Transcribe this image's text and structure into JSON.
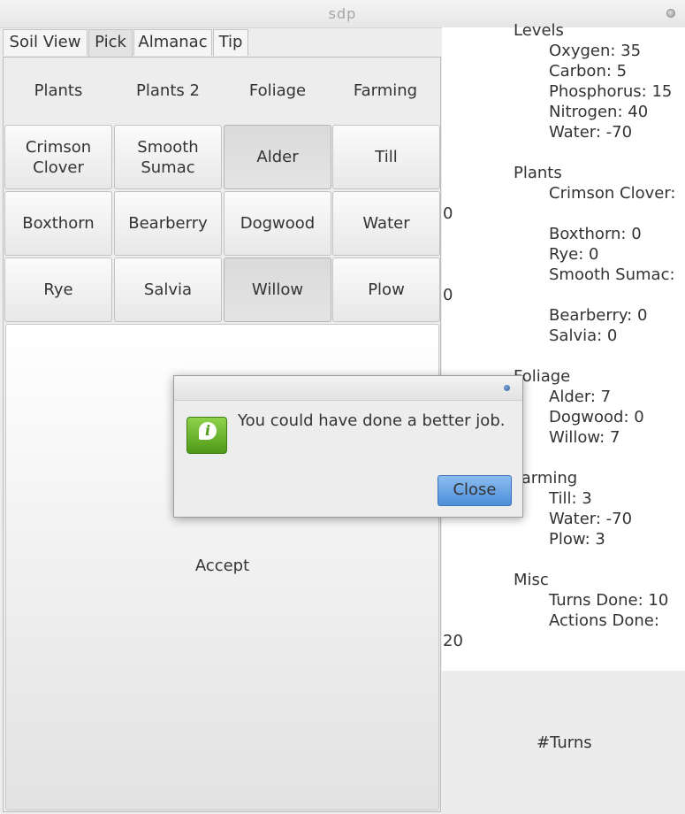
{
  "window": {
    "title": "sdp"
  },
  "tabs": [
    "Soil View",
    "Pick",
    "Almanac",
    "Tip"
  ],
  "categories": [
    "Plants",
    "Plants 2",
    "Foliage",
    "Farming"
  ],
  "buttons": {
    "crimson_clover": "Crimson\nClover",
    "smooth_sumac": "Smooth\nSumac",
    "alder": "Alder",
    "till": "Till",
    "boxthorn": "Boxthorn",
    "bearberry": "Bearberry",
    "dogwood": "Dogwood",
    "water": "Water",
    "rye": "Rye",
    "salvia": "Salvia",
    "willow": "Willow",
    "plow": "Plow"
  },
  "accept_label": "Accept",
  "stats": {
    "levels_head": "Levels",
    "oxygen": "Oxygen: 35",
    "carbon": "Carbon: 5",
    "phosphorus": "Phosphorus: 15",
    "nitrogen": "Nitrogen: 40",
    "water": "Water: -70",
    "plants_head": "Plants",
    "crimson_clover": "Crimson Clover:",
    "crimson_clover_val": "0",
    "boxthorn": "Boxthorn: 0",
    "rye": "Rye: 0",
    "smooth_sumac": "Smooth Sumac:",
    "smooth_sumac_val": "0",
    "bearberry": "Bearberry: 0",
    "salvia": "Salvia: 0",
    "foliage_head": "Foliage",
    "alder": "Alder: 7",
    "dogwood": "Dogwood: 0",
    "willow": "Willow: 7",
    "farming_head": "Farming",
    "till": "Till: 3",
    "farm_water": "Water: -70",
    "plow": "Plow: 3",
    "misc_head": "Misc",
    "turns_done": "Turns Done: 10",
    "actions_done": "Actions Done:",
    "actions_done_val": "20"
  },
  "turns_label": "#Turns",
  "dialog": {
    "message": "You could have done a better job.",
    "close_label": "Close",
    "icon": "info-icon"
  }
}
